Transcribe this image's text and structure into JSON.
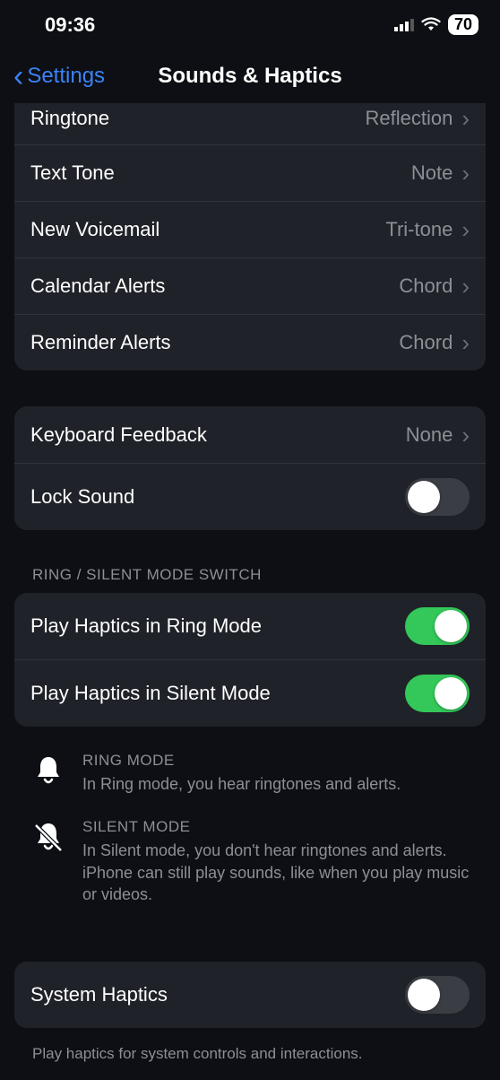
{
  "status": {
    "time": "09:36",
    "battery": "70"
  },
  "nav": {
    "back": "Settings",
    "title": "Sounds & Haptics"
  },
  "group1": {
    "ringtone": {
      "label": "Ringtone",
      "value": "Reflection"
    },
    "text_tone": {
      "label": "Text Tone",
      "value": "Note"
    },
    "new_voicemail": {
      "label": "New Voicemail",
      "value": "Tri-tone"
    },
    "calendar_alerts": {
      "label": "Calendar Alerts",
      "value": "Chord"
    },
    "reminder_alerts": {
      "label": "Reminder Alerts",
      "value": "Chord"
    }
  },
  "group2": {
    "keyboard_feedback": {
      "label": "Keyboard Feedback",
      "value": "None"
    },
    "lock_sound": {
      "label": "Lock Sound",
      "on": false
    }
  },
  "section_ring_silent_header": "RING / SILENT MODE SWITCH",
  "group3": {
    "haptics_ring": {
      "label": "Play Haptics in Ring Mode",
      "on": true
    },
    "haptics_silent": {
      "label": "Play Haptics in Silent Mode",
      "on": true
    }
  },
  "info_ring": {
    "title": "RING MODE",
    "desc": "In Ring mode, you hear ringtones and alerts."
  },
  "info_silent": {
    "title": "SILENT MODE",
    "desc": "In Silent mode, you don't hear ringtones and alerts. iPhone can still play sounds, like when you play music or videos."
  },
  "group4": {
    "system_haptics": {
      "label": "System Haptics",
      "on": false
    }
  },
  "footer_system_haptics": "Play haptics for system controls and interactions."
}
